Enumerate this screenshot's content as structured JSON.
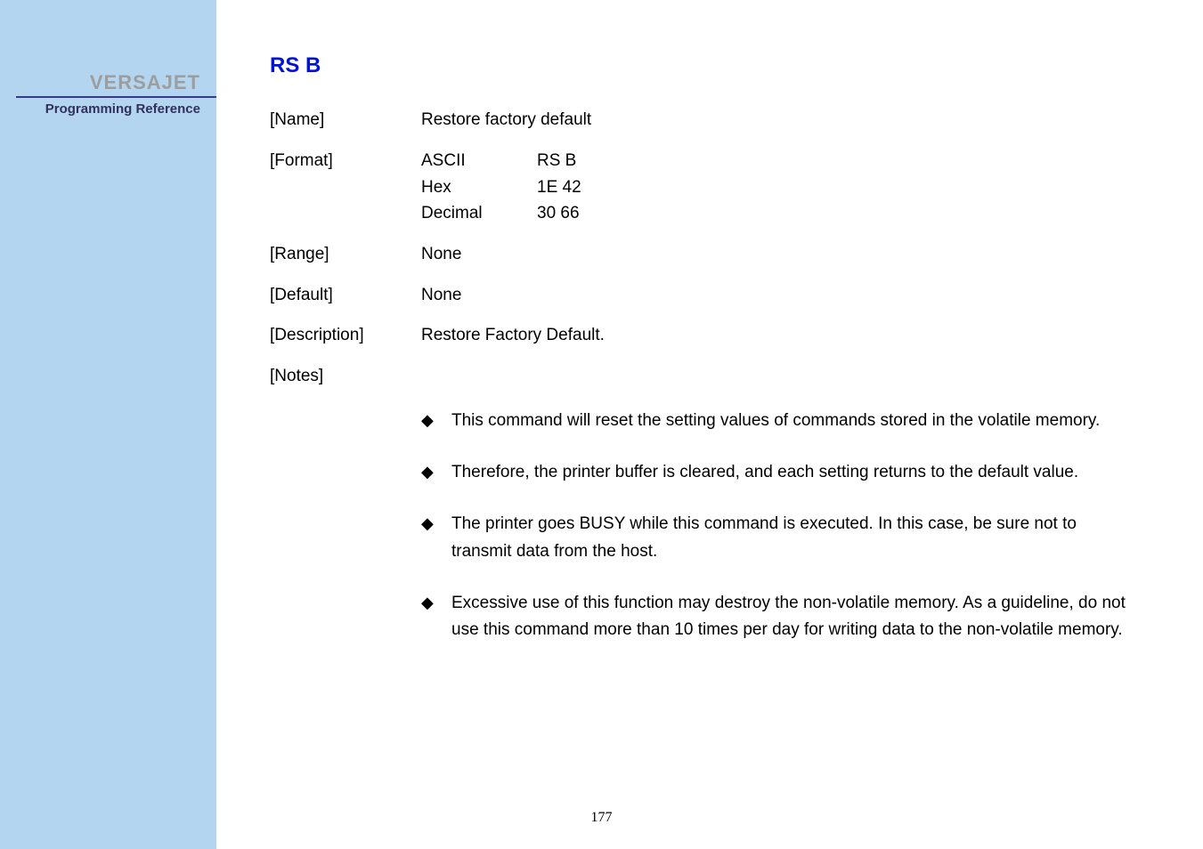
{
  "sidebar": {
    "brand": "VERSAJET",
    "subtitle": "Programming Reference"
  },
  "command": {
    "title": "RS B",
    "rows": {
      "name_label": "[Name]",
      "name_value": "Restore factory default",
      "format_label": "[Format]",
      "format": {
        "ascii_label": "ASCII",
        "ascii_value": "RS B",
        "hex_label": "Hex",
        "hex_value": "1E 42",
        "dec_label": "Decimal",
        "dec_value": "30 66"
      },
      "range_label": "[Range]",
      "range_value": "None",
      "default_label": "[Default]",
      "default_value": "None",
      "desc_label": "[Description]",
      "desc_value": "Restore Factory Default.",
      "notes_label": "[Notes]"
    },
    "notes": [
      "This command will reset the setting values of commands stored in the volatile memory.",
      "Therefore, the printer buffer is cleared, and each setting returns to the default value.",
      "The printer goes BUSY while this command is executed. In this case, be sure not to transmit data from the host.",
      "Excessive use of this function may destroy the non-volatile memory. As a guideline, do not use this command more than 10 times per day for writing data to the non-volatile memory."
    ]
  },
  "page_number": "177"
}
